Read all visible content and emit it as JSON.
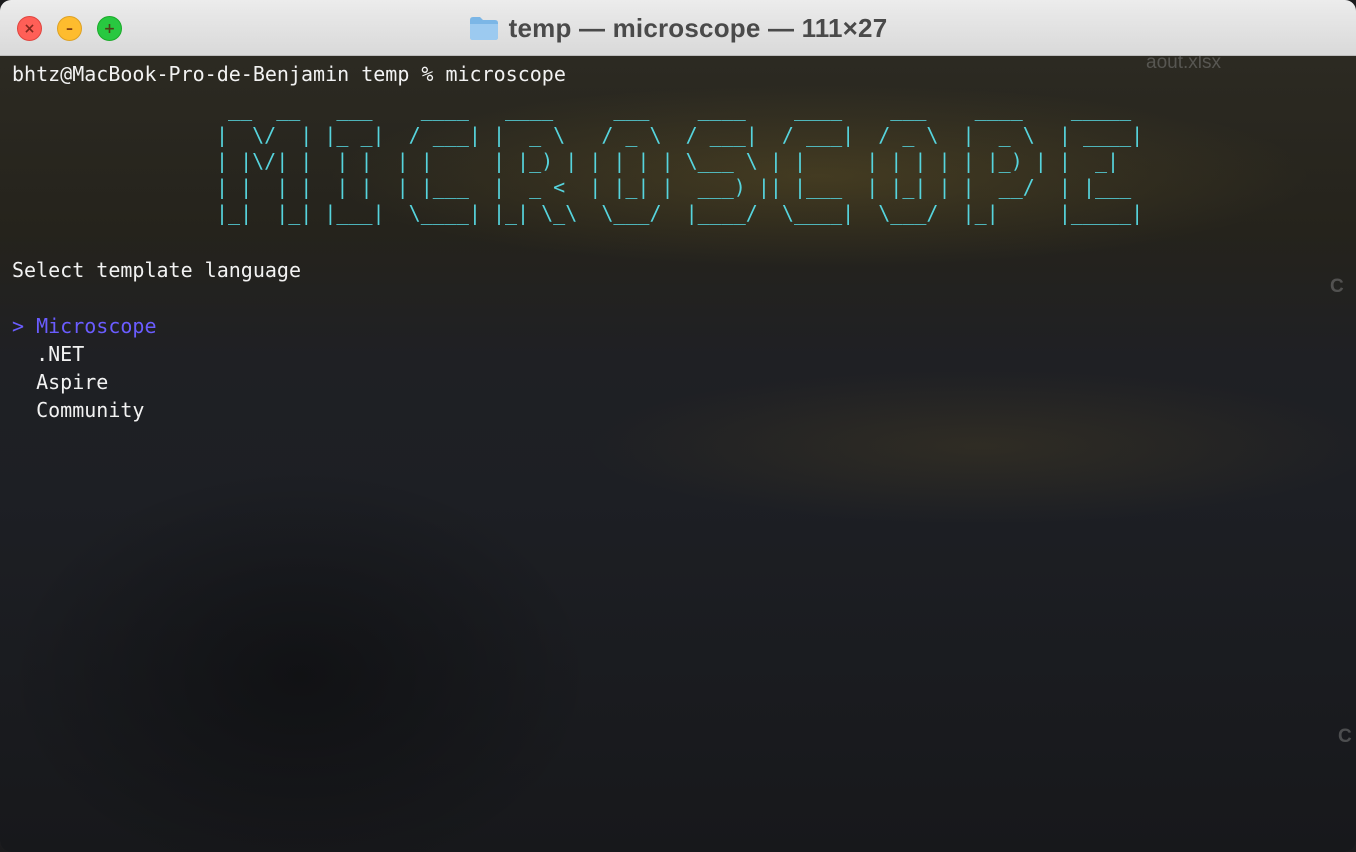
{
  "window": {
    "title": "temp — microscope — 111×27",
    "folder_icon": "folder-icon"
  },
  "background": {
    "desktop_label": "aout.xlsx",
    "edge_letter_1": "C",
    "edge_letter_2": "C"
  },
  "terminal": {
    "prompt_line": "bhtz@MacBook-Pro-de-Benjamin temp % microscope",
    "banner_lines": [
      " __  __   ___    ____   ____     ___    ____    ____    ___    ____    _____",
      "|  \\/  | |_ _|  / ___| |  _ \\   / _ \\  / ___|  / ___|  / _ \\  |  _ \\  | ____|",
      "| |\\/| |  | |  | |     | |_) | | | | | \\___ \\ | |     | | | | | |_) | |  _|",
      "| |  | |  | |  | |___  |  _ <  | |_| |  ___) || |___  | |_| | |  __/  | |___",
      "|_|  |_| |___|  \\____| |_| \\_\\  \\___/  |____/  \\____|  \\___/  |_|     |_____|"
    ],
    "banner_color": "#56d4dd",
    "question": "Select template language",
    "selected_color": "#6a5cff",
    "options": [
      {
        "label": "Microscope",
        "selected": true,
        "marker": ">"
      },
      {
        "label": ".NET",
        "selected": false,
        "marker": ""
      },
      {
        "label": "Aspire",
        "selected": false,
        "marker": ""
      },
      {
        "label": "Community",
        "selected": false,
        "marker": ""
      }
    ]
  }
}
